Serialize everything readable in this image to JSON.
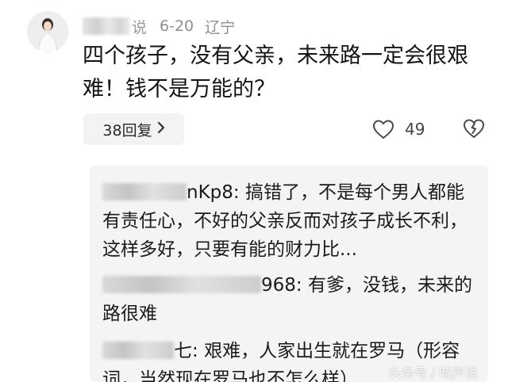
{
  "comment": {
    "author_visible_tail": "说",
    "date": "6-20",
    "location": "辽宁",
    "text": "四个孩子，没有父亲，未来路一定会很艰难！钱不是万能的？",
    "reply_count_label": "38回复",
    "like_count": "49"
  },
  "replies": [
    {
      "author_visible_tail": "nKp8",
      "text": "搞错了，不是每个男人都能有责任心，不好的父亲反而对孩子成长不利，这样多好，只要有能的财力比..."
    },
    {
      "author_visible_tail": "968",
      "text": "有爹，没钱，未来的路很难"
    },
    {
      "author_visible_tail": "七",
      "text": "艰难，人家出生就在罗马（形容词，当然现在罗马也不怎么样）"
    }
  ],
  "watermark": "头条号 / 晓声说",
  "icons": {
    "reply_chevron": "chevron-right-icon",
    "like": "heart-outline-icon",
    "dislike": "broken-heart-icon"
  }
}
